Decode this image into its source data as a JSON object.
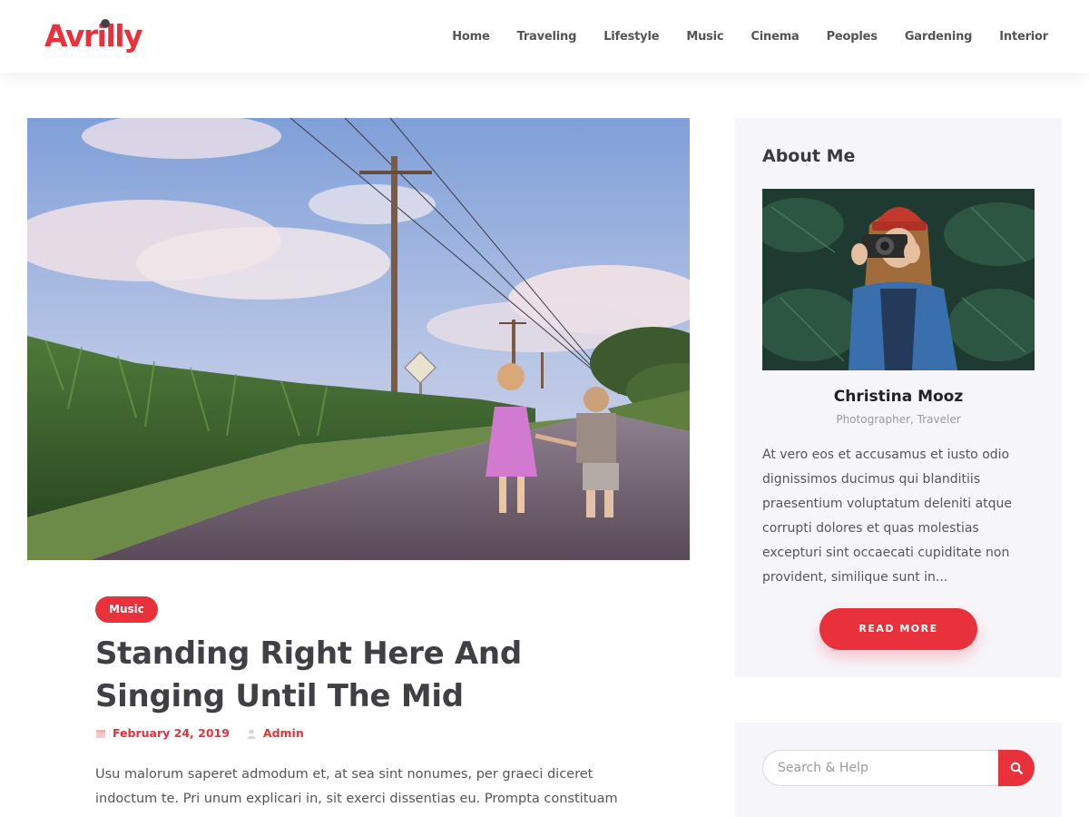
{
  "brand": {
    "logo_text": "Avrilly",
    "accent_color": "#e8313b"
  },
  "nav": {
    "items": [
      {
        "label": "Home"
      },
      {
        "label": "Traveling"
      },
      {
        "label": "Lifestyle"
      },
      {
        "label": "Music"
      },
      {
        "label": "Cinema"
      },
      {
        "label": "Peoples"
      },
      {
        "label": "Gardening"
      },
      {
        "label": "Interior"
      }
    ]
  },
  "post": {
    "category": "Music",
    "title": "Standing Right Here And Singing Until The Mid",
    "date": "February 24, 2019",
    "author": "Admin",
    "excerpt": "Usu malorum saperet admodum et, at sea sint nonumes, per graeci diceret indoctum te. Pri unum explicari in, sit exerci dissentias eu. Prompta constituam",
    "image_icon": "photo-children-walking-road"
  },
  "sidebar": {
    "about": {
      "heading": "About Me",
      "name": "Christina Mooz",
      "role": "Photographer, Traveler",
      "bio": "At vero eos et accusamus et iusto odio dignissimos ducimus qui blanditiis praesentium voluptatum deleniti atque corrupti dolores et quas molestias excepturi sint occaecati cupiditate non provident, similique sunt in...",
      "button_label": "READ MORE",
      "image_icon": "photo-woman-with-camera"
    },
    "search": {
      "placeholder": "Search & Help",
      "button_icon": "search-icon"
    }
  }
}
